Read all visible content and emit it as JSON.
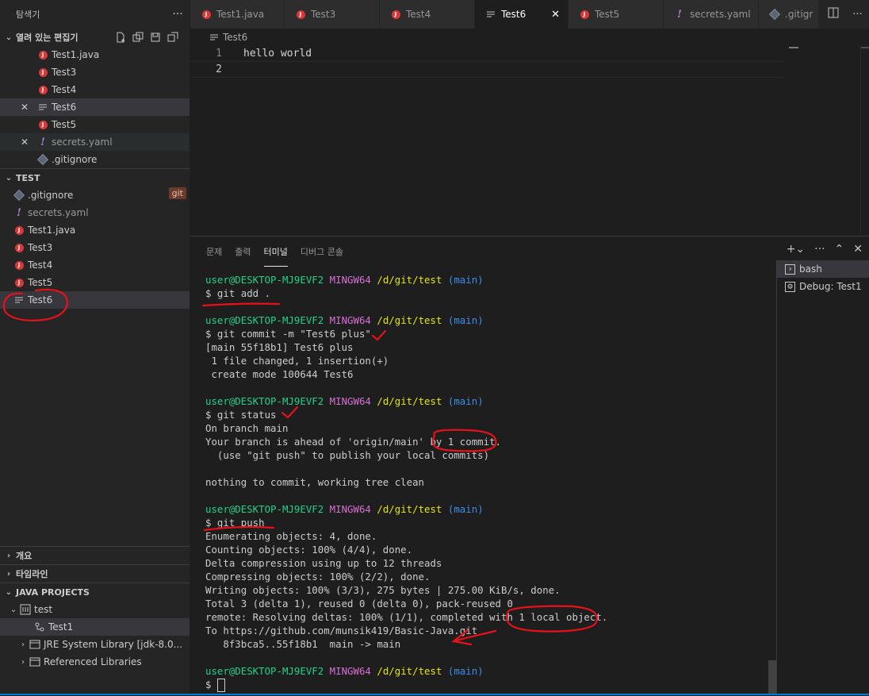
{
  "sidebar": {
    "title": "탐색기",
    "more": "···",
    "open_editors": {
      "label": "열려 있는 편집기",
      "items": [
        {
          "name": "Test1.java",
          "icon": "java",
          "close": ""
        },
        {
          "name": "Test3",
          "icon": "java",
          "close": ""
        },
        {
          "name": "Test4",
          "icon": "java",
          "close": ""
        },
        {
          "name": "Test6",
          "icon": "text",
          "close": "✕"
        },
        {
          "name": "Test5",
          "icon": "java",
          "close": ""
        },
        {
          "name": "secrets.yaml",
          "icon": "yaml",
          "close": "✕"
        },
        {
          "name": ".gitignore",
          "icon": "git",
          "close": ""
        }
      ]
    },
    "folder": {
      "label": "TEST",
      "items": [
        {
          "name": ".gitignore",
          "icon": "git",
          "badge": "git"
        },
        {
          "name": "secrets.yaml",
          "icon": "yaml"
        },
        {
          "name": "Test1.java",
          "icon": "java"
        },
        {
          "name": "Test3",
          "icon": "java"
        },
        {
          "name": "Test4",
          "icon": "java"
        },
        {
          "name": "Test5",
          "icon": "java"
        },
        {
          "name": "Test6",
          "icon": "text"
        }
      ]
    },
    "outline_label": "개요",
    "timeline_label": "타임라인",
    "java_projects": {
      "label": "JAVA PROJECTS",
      "project": "test",
      "items": [
        "Test1",
        "JRE System Library [jdk-8.0...",
        "Referenced Libraries"
      ]
    }
  },
  "tabs": [
    {
      "label": "Test1.java",
      "icon": "java"
    },
    {
      "label": "Test3",
      "icon": "java"
    },
    {
      "label": "Test4",
      "icon": "java"
    },
    {
      "label": "Test6",
      "icon": "text",
      "active": true
    },
    {
      "label": "Test5",
      "icon": "java"
    },
    {
      "label": "secrets.yaml",
      "icon": "yaml"
    },
    {
      "label": ".gitigr",
      "icon": "git"
    }
  ],
  "editor": {
    "breadcrumb": "Test6",
    "lines": [
      {
        "num": "1",
        "text": "hello world"
      },
      {
        "num": "2",
        "text": ""
      }
    ]
  },
  "panel": {
    "tabs": [
      "문제",
      "출력",
      "터미널",
      "디버그 콘솔"
    ],
    "active_tab": "터미널",
    "terminals": [
      "bash",
      "Debug: Test1"
    ],
    "prompt": {
      "user": "user@DESKTOP-MJ9EVF2",
      "host": "MINGW64",
      "path": "/d/git/test",
      "branch": "(main)"
    },
    "lines": [
      {
        "type": "prompt"
      },
      {
        "type": "text",
        "text": "$ git add ."
      },
      {
        "type": "text",
        "text": ""
      },
      {
        "type": "prompt"
      },
      {
        "type": "text",
        "text": "$ git commit -m \"Test6 plus\""
      },
      {
        "type": "text",
        "text": "[main 55f18b1] Test6 plus"
      },
      {
        "type": "text",
        "text": " 1 file changed, 1 insertion(+)"
      },
      {
        "type": "text",
        "text": " create mode 100644 Test6"
      },
      {
        "type": "text",
        "text": ""
      },
      {
        "type": "prompt"
      },
      {
        "type": "text",
        "text": "$ git status"
      },
      {
        "type": "text",
        "text": "On branch main"
      },
      {
        "type": "text",
        "text": "Your branch is ahead of 'origin/main' by 1 commit."
      },
      {
        "type": "text",
        "text": "  (use \"git push\" to publish your local commits)"
      },
      {
        "type": "text",
        "text": ""
      },
      {
        "type": "text",
        "text": "nothing to commit, working tree clean"
      },
      {
        "type": "text",
        "text": ""
      },
      {
        "type": "prompt"
      },
      {
        "type": "text",
        "text": "$ git push"
      },
      {
        "type": "text",
        "text": "Enumerating objects: 4, done."
      },
      {
        "type": "text",
        "text": "Counting objects: 100% (4/4), done."
      },
      {
        "type": "text",
        "text": "Delta compression using up to 12 threads"
      },
      {
        "type": "text",
        "text": "Compressing objects: 100% (2/2), done."
      },
      {
        "type": "text",
        "text": "Writing objects: 100% (3/3), 275 bytes | 275.00 KiB/s, done."
      },
      {
        "type": "text",
        "text": "Total 3 (delta 1), reused 0 (delta 0), pack-reused 0"
      },
      {
        "type": "text",
        "text": "remote: Resolving deltas: 100% (1/1), completed with 1 local object."
      },
      {
        "type": "text",
        "text": "To https://github.com/munsik419/Basic-Java.git"
      },
      {
        "type": "text",
        "text": "   8f3bca5..55f18b1  main -> main"
      },
      {
        "type": "text",
        "text": ""
      },
      {
        "type": "prompt"
      },
      {
        "type": "cursor",
        "text": "$ "
      }
    ]
  },
  "colors": {
    "accent": "#007acc",
    "annotation": "#e8101a",
    "java_icon": "#d9383a"
  }
}
